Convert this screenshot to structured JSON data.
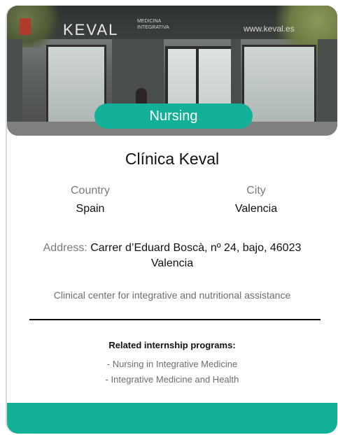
{
  "photo": {
    "logo_text": "KEVAL",
    "logo_subtext": "MEDICINA INTEGRATIVA",
    "website_text": "www.keval.es"
  },
  "badge": {
    "label": "Nursing"
  },
  "clinic": {
    "name": "Clínica Keval",
    "country_label": "Country",
    "country_value": "Spain",
    "city_label": "City",
    "city_value": "Valencia",
    "address_label": "Address:",
    "address_value": "Carrer d’Eduard Boscà, nº 24, bajo, 46023 Valencia",
    "description": "Clinical center for integrative and nutritional assistance"
  },
  "related": {
    "title": "Related internship programs:",
    "items": [
      "- Nursing in Integrative Medicine",
      "- Integrative Medicine and Health"
    ]
  },
  "colors": {
    "accent": "#12b197"
  }
}
